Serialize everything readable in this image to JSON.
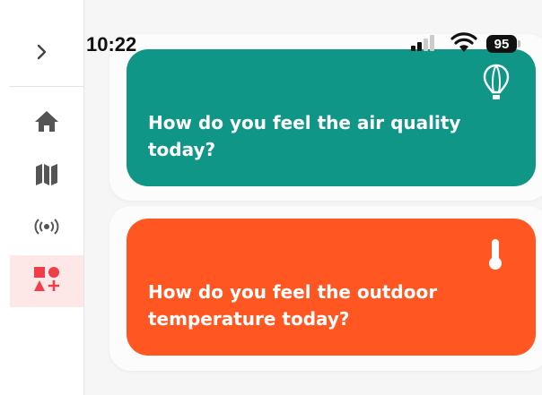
{
  "status_bar": {
    "time": "10:22",
    "battery": "95",
    "icons": [
      "signal-icon",
      "wifi-icon",
      "battery-icon"
    ]
  },
  "sidebar": {
    "toggle_icon": "chevron-right-icon",
    "items": [
      {
        "icon": "home-icon",
        "active": false
      },
      {
        "icon": "map-icon",
        "active": false
      },
      {
        "icon": "broadcast-icon",
        "active": false
      },
      {
        "icon": "shapes-add-icon",
        "active": true
      }
    ],
    "active_bg": "#fde7e7",
    "active_color": "#ef3e4a"
  },
  "cards": [
    {
      "question": "How do you feel the air quality today?",
      "icon": "air-balloon-icon",
      "color": "#0f9687"
    },
    {
      "question": "How do you feel the outdoor temperature today?",
      "icon": "thermometer-icon",
      "color": "#ff5622"
    }
  ]
}
